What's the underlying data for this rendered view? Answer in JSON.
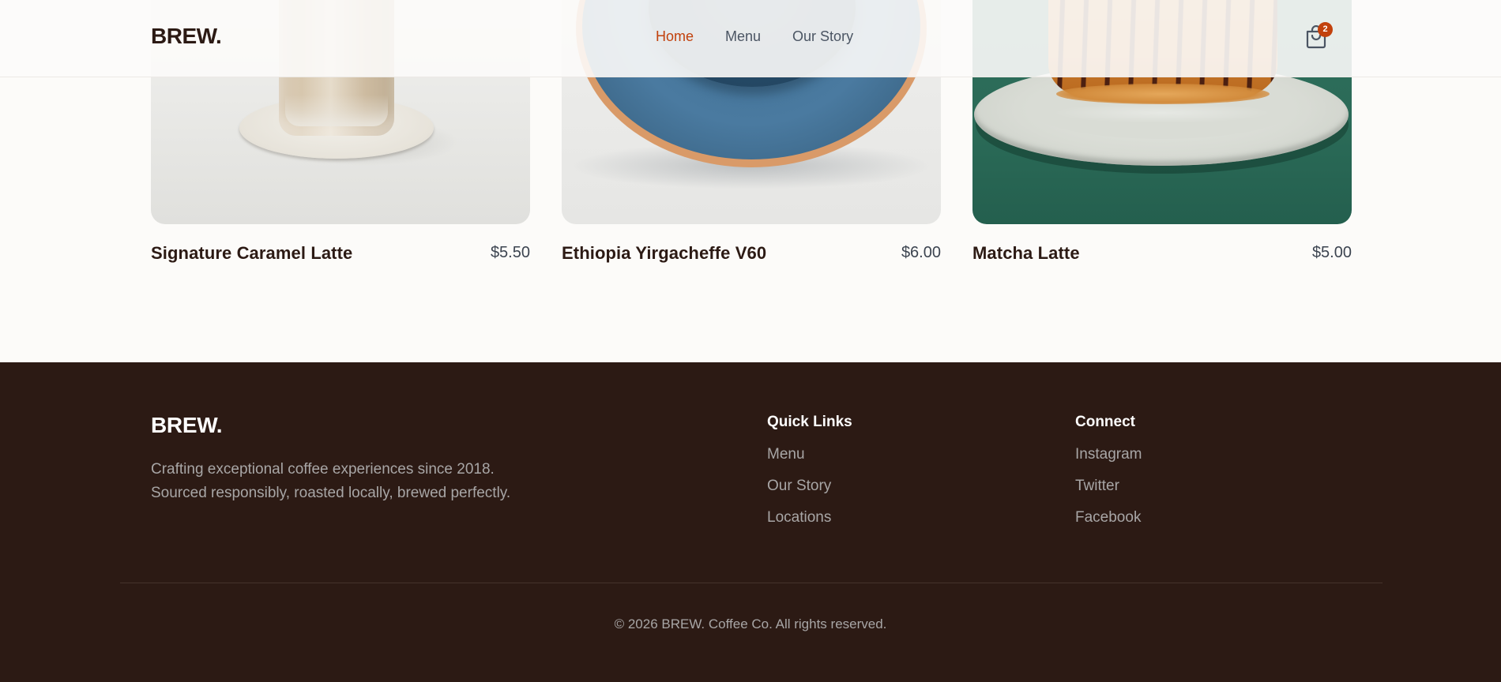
{
  "header": {
    "logo": "BREW.",
    "nav": [
      {
        "label": "Home",
        "active": true
      },
      {
        "label": "Menu",
        "active": false
      },
      {
        "label": "Our Story",
        "active": false
      }
    ],
    "cart_icon": "shopping-bag-icon",
    "cart_count": "2",
    "accent_color": "#c2410c"
  },
  "products": [
    {
      "name": "Signature Caramel Latte",
      "price": "$5.50",
      "image": "latte-glass-on-coaster"
    },
    {
      "name": "Ethiopia Yirgacheffe V60",
      "price": "$6.00",
      "image": "blue-coffee-cup-on-saucer"
    },
    {
      "name": "Matcha Latte",
      "price": "$5.00",
      "image": "pastry-on-plate"
    }
  ],
  "footer": {
    "logo": "BREW.",
    "description": "Crafting exceptional coffee experiences since 2018. Sourced responsibly, roasted locally, brewed perfectly.",
    "quick_links": {
      "title": "Quick Links",
      "items": [
        "Menu",
        "Our Story",
        "Locations"
      ]
    },
    "connect": {
      "title": "Connect",
      "items": [
        "Instagram",
        "Twitter",
        "Facebook"
      ]
    },
    "copyright": "© 2026 BREW. Coffee Co. All rights reserved.",
    "background_color": "#2c1a14"
  }
}
